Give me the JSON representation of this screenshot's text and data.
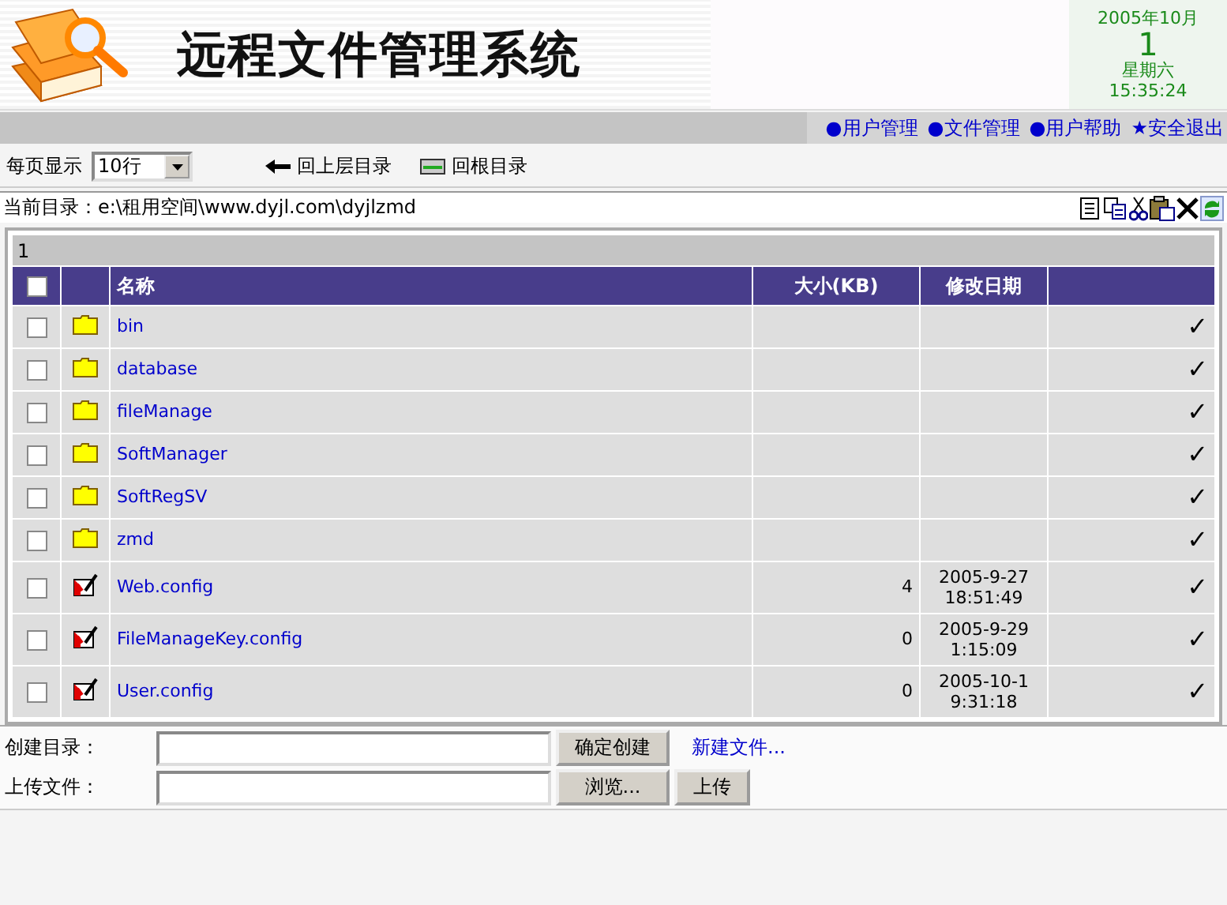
{
  "header": {
    "title": "远程文件管理系统",
    "date": {
      "month": "2005年10月",
      "day": "1",
      "weekday": "星期六",
      "time": "15:35:24"
    }
  },
  "nav": [
    {
      "label": "用户管理",
      "bullet": "●"
    },
    {
      "label": "文件管理",
      "bullet": "●"
    },
    {
      "label": "用户帮助",
      "bullet": "●"
    },
    {
      "label": "安全退出",
      "bullet": "★"
    }
  ],
  "toolbar": {
    "page_size_label": "每页显示",
    "page_size": "10行",
    "up_label": "回上层目录",
    "root_label": "回根目录"
  },
  "path": {
    "label": "当前目录：",
    "value": "e:\\租用空间\\www.dyjl.com\\dyjlzmd"
  },
  "table": {
    "page": "1",
    "all_checked": false,
    "columns": [
      "名称",
      "大小(KB)",
      "修改日期"
    ],
    "rows": [
      {
        "kind": "folder",
        "name": "bin",
        "size": "",
        "date": "",
        "time": "",
        "checked": false,
        "mark": "✓"
      },
      {
        "kind": "folder",
        "name": "database",
        "size": "",
        "date": "",
        "time": "",
        "checked": false,
        "mark": "✓"
      },
      {
        "kind": "folder",
        "name": "fileManage",
        "size": "",
        "date": "",
        "time": "",
        "checked": false,
        "mark": "✓"
      },
      {
        "kind": "folder",
        "name": "SoftManager",
        "size": "",
        "date": "",
        "time": "",
        "checked": false,
        "mark": "✓"
      },
      {
        "kind": "folder",
        "name": "SoftRegSV",
        "size": "",
        "date": "",
        "time": "",
        "checked": false,
        "mark": "✓"
      },
      {
        "kind": "folder",
        "name": "zmd",
        "size": "",
        "date": "",
        "time": "",
        "checked": false,
        "mark": "✓"
      },
      {
        "kind": "file",
        "name": "Web.config",
        "size": "4",
        "date": "2005-9-27",
        "time": "18:51:49",
        "checked": false,
        "mark": "✓"
      },
      {
        "kind": "file",
        "name": "FileManageKey.config",
        "size": "0",
        "date": "2005-9-29",
        "time": "1:15:09",
        "checked": false,
        "mark": "✓"
      },
      {
        "kind": "file",
        "name": "User.config",
        "size": "0",
        "date": "2005-10-1",
        "time": "9:31:18",
        "checked": false,
        "mark": "✓"
      }
    ]
  },
  "forms": {
    "create_label": "创建目录：",
    "create_button": "确定创建",
    "new_file_link": "新建文件...",
    "upload_label": "上传文件：",
    "browse_button": "浏览...",
    "upload_button": "上传"
  }
}
